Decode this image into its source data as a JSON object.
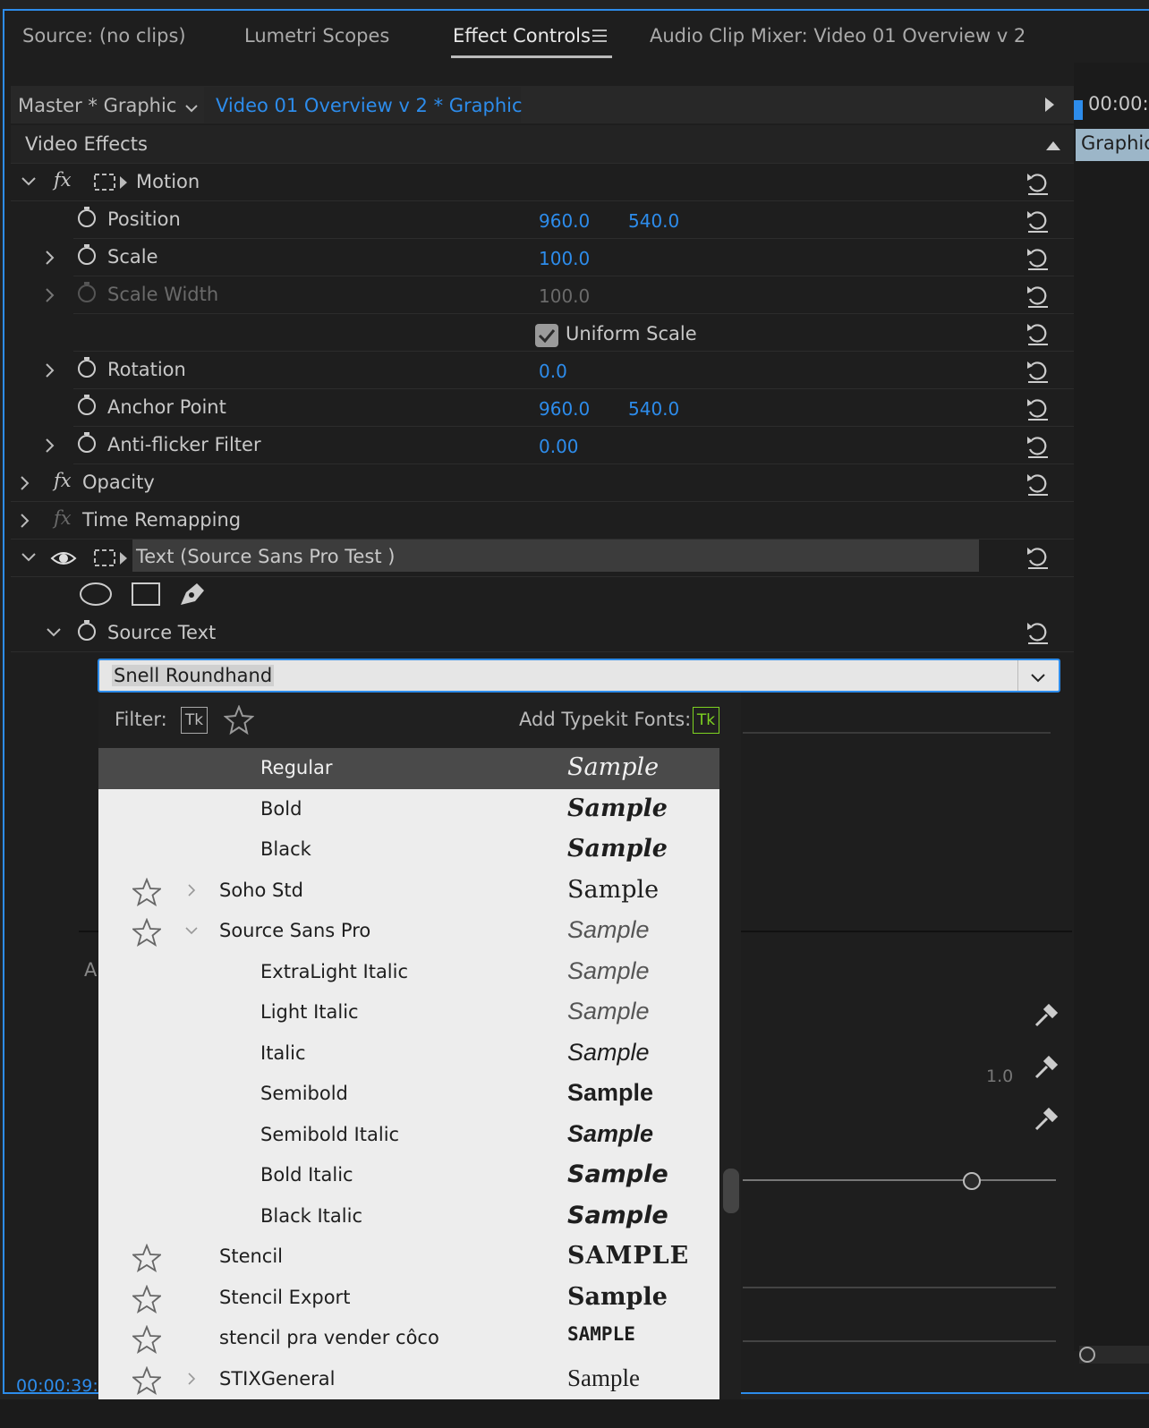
{
  "tabs": [
    {
      "label": "Source: (no clips)"
    },
    {
      "label": "Lumetri Scopes"
    },
    {
      "label": "Effect Controls"
    },
    {
      "label": "Audio Clip Mixer: Video 01 Overview v 2"
    }
  ],
  "header": {
    "master_label": "Master * Graphic",
    "clip_label": "Video 01 Overview v 2 * Graphic",
    "timecode": "00:00:",
    "timeline_clip": "Graphic"
  },
  "section": {
    "title": "Video Effects"
  },
  "motion": {
    "title": "Motion",
    "position": {
      "label": "Position",
      "x": "960.0",
      "y": "540.0"
    },
    "scale": {
      "label": "Scale",
      "value": "100.0"
    },
    "scale_width": {
      "label": "Scale Width",
      "value": "100.0"
    },
    "uniform_scale": {
      "label": "Uniform Scale",
      "checked": true
    },
    "rotation": {
      "label": "Rotation",
      "value": "0.0"
    },
    "anchor": {
      "label": "Anchor Point",
      "x": "960.0",
      "y": "540.0"
    },
    "antiflicker": {
      "label": "Anti-flicker Filter",
      "value": "0.00"
    }
  },
  "opacity": {
    "title": "Opacity"
  },
  "time_remap": {
    "title": "Time Remapping"
  },
  "text_effect": {
    "title": "Text (Source Sans Pro Test )",
    "source_text_label": "Source Text",
    "font_value": "Snell Roundhand"
  },
  "dropdown": {
    "filter_label": "Filter:",
    "tk_badge": "Tk",
    "add_typekit_label": "Add Typekit Fonts:",
    "add_typekit_badge": "Tk",
    "items": [
      {
        "name": "Regular",
        "sample": "Sample",
        "indent": 2,
        "selected": true,
        "star": false,
        "chevron": "",
        "sample_style": "script"
      },
      {
        "name": "Bold",
        "sample": "Sample",
        "indent": 2,
        "selected": false,
        "star": false,
        "chevron": "",
        "sample_style": "script-bold"
      },
      {
        "name": "Black",
        "sample": "Sample",
        "indent": 2,
        "selected": false,
        "star": false,
        "chevron": "",
        "sample_style": "script-black"
      },
      {
        "name": "Soho Std",
        "sample": "Sample",
        "indent": 1,
        "selected": false,
        "star": true,
        "chevron": "right",
        "sample_style": "slab"
      },
      {
        "name": "Source Sans Pro",
        "sample": "Sample",
        "indent": 1,
        "selected": false,
        "star": true,
        "chevron": "down",
        "sample_style": "light-italic"
      },
      {
        "name": "ExtraLight Italic",
        "sample": "Sample",
        "indent": 2,
        "selected": false,
        "star": false,
        "chevron": "",
        "sample_style": "light-italic"
      },
      {
        "name": "Light Italic",
        "sample": "Sample",
        "indent": 2,
        "selected": false,
        "star": false,
        "chevron": "",
        "sample_style": "light-italic"
      },
      {
        "name": "Italic",
        "sample": "Sample",
        "indent": 2,
        "selected": false,
        "star": false,
        "chevron": "",
        "sample_style": "italic"
      },
      {
        "name": "Semibold",
        "sample": "Sample",
        "indent": 2,
        "selected": false,
        "star": false,
        "chevron": "",
        "sample_style": "semibold"
      },
      {
        "name": "Semibold Italic",
        "sample": "Sample",
        "indent": 2,
        "selected": false,
        "star": false,
        "chevron": "",
        "sample_style": "semibold-italic"
      },
      {
        "name": "Bold Italic",
        "sample": "Sample",
        "indent": 2,
        "selected": false,
        "star": false,
        "chevron": "",
        "sample_style": "bold-italic"
      },
      {
        "name": "Black Italic",
        "sample": "Sample",
        "indent": 2,
        "selected": false,
        "star": false,
        "chevron": "",
        "sample_style": "bold-italic"
      },
      {
        "name": "Stencil",
        "sample": "SAMPLE",
        "indent": 1,
        "selected": false,
        "star": true,
        "chevron": "",
        "sample_style": "stencil"
      },
      {
        "name": "Stencil Export",
        "sample": "Sample",
        "indent": 1,
        "selected": false,
        "star": true,
        "chevron": "",
        "sample_style": "stencil-export"
      },
      {
        "name": "stencil pra vender côco",
        "sample": "SAMPLE",
        "indent": 1,
        "selected": false,
        "star": true,
        "chevron": "",
        "sample_style": "stencil-small"
      },
      {
        "name": "STIXGeneral",
        "sample": "Sample",
        "indent": 1,
        "selected": false,
        "star": true,
        "chevron": "right",
        "sample_style": "serif"
      }
    ]
  },
  "background_partial": {
    "letter_a": "A",
    "value_1_0": "1.0",
    "bottom_timecode": "00:00:39:"
  },
  "colors": {
    "accent": "#2d8ceb",
    "typekit_green": "#7ed321"
  }
}
